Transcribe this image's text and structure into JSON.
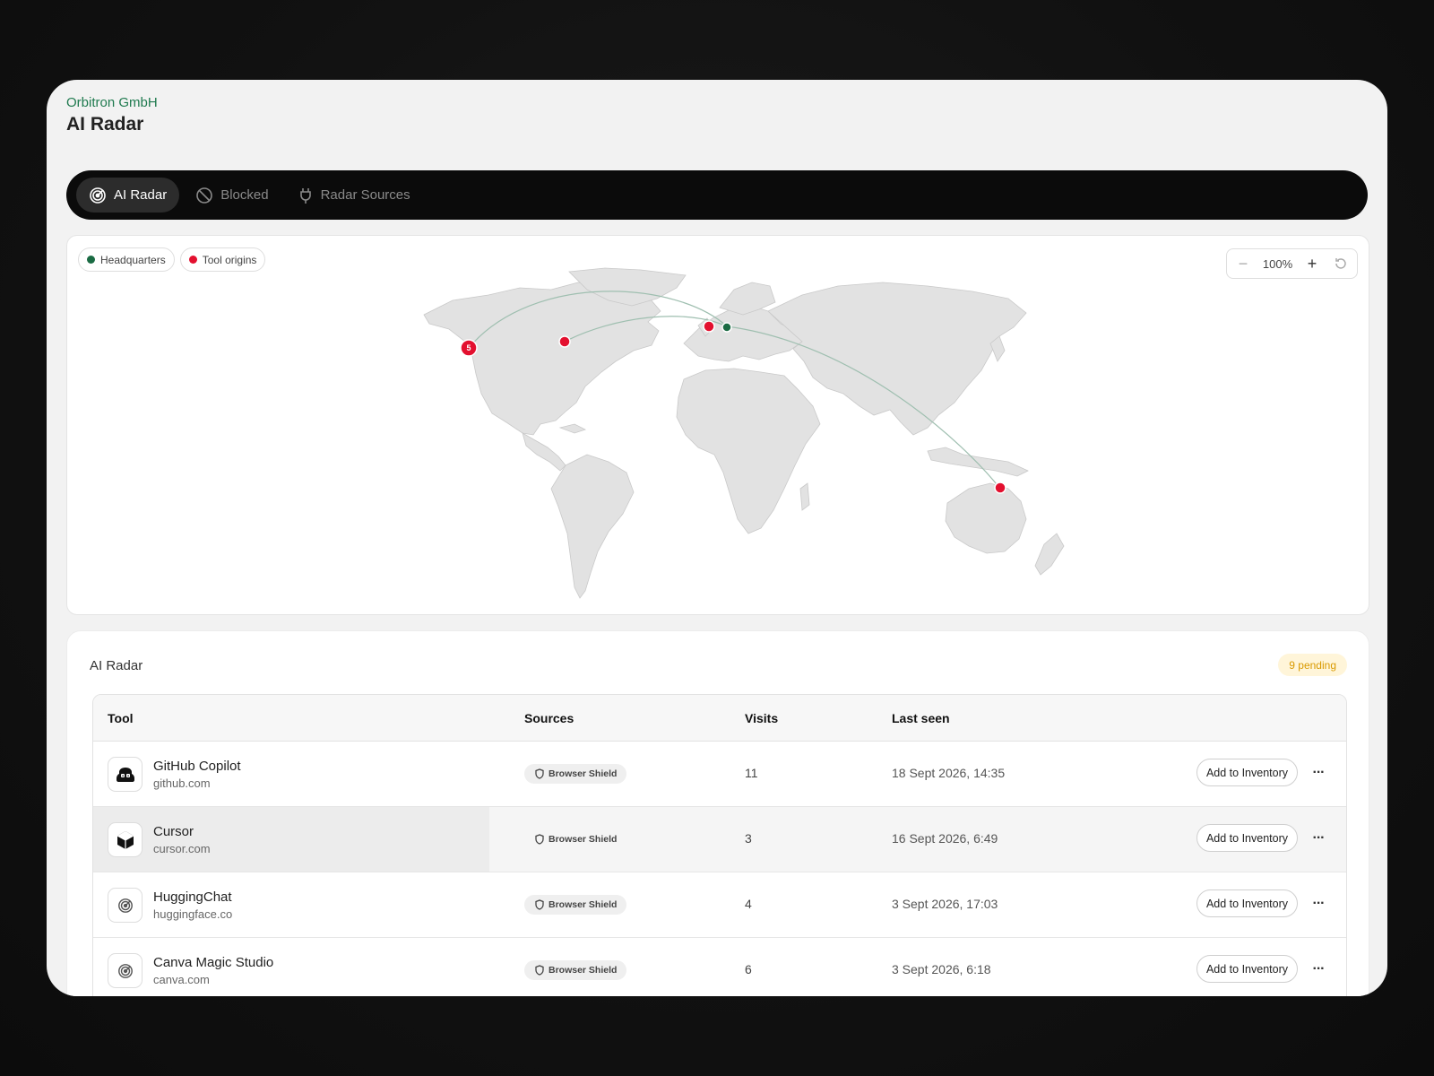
{
  "header": {
    "org": "Orbitron GmbH",
    "title": "AI Radar"
  },
  "nav": {
    "tabs": [
      {
        "label": "AI Radar",
        "icon": "radar-icon",
        "active": true
      },
      {
        "label": "Blocked",
        "icon": "blocked-icon",
        "active": false
      },
      {
        "label": "Radar Sources",
        "icon": "plug-icon",
        "active": false
      }
    ]
  },
  "map": {
    "legend": [
      {
        "label": "Headquarters",
        "color": "#1a6b43"
      },
      {
        "label": "Tool origins",
        "color": "#e3102f"
      }
    ],
    "zoom_level": "100%",
    "cluster_count": "5",
    "colors": {
      "land": "#e2e2e2",
      "arc": "#9fbfb0",
      "origin": "#e3102f",
      "hq": "#1a6b43"
    }
  },
  "table_section": {
    "title": "AI Radar",
    "pending_badge": "9 pending",
    "columns": [
      "Tool",
      "Sources",
      "Visits",
      "Last seen"
    ],
    "rows": [
      {
        "name": "GitHub Copilot",
        "domain": "github.com",
        "icon": "copilot-icon",
        "source": "Browser Shield",
        "visits": "11",
        "last_seen": "18 Sept 2026, 14:35",
        "action": "Add to Inventory"
      },
      {
        "name": "Cursor",
        "domain": "cursor.com",
        "icon": "cursor-cube-icon",
        "source": "Browser Shield",
        "visits": "3",
        "last_seen": "16 Sept 2026, 6:49",
        "action": "Add to Inventory"
      },
      {
        "name": "HuggingChat",
        "domain": "huggingface.co",
        "icon": "radar-icon",
        "source": "Browser Shield",
        "visits": "4",
        "last_seen": "3 Sept 2026, 17:03",
        "action": "Add to Inventory"
      },
      {
        "name": "Canva Magic Studio",
        "domain": "canva.com",
        "icon": "radar-icon",
        "source": "Browser Shield",
        "visits": "6",
        "last_seen": "3 Sept 2026, 6:18",
        "action": "Add to Inventory"
      }
    ]
  }
}
